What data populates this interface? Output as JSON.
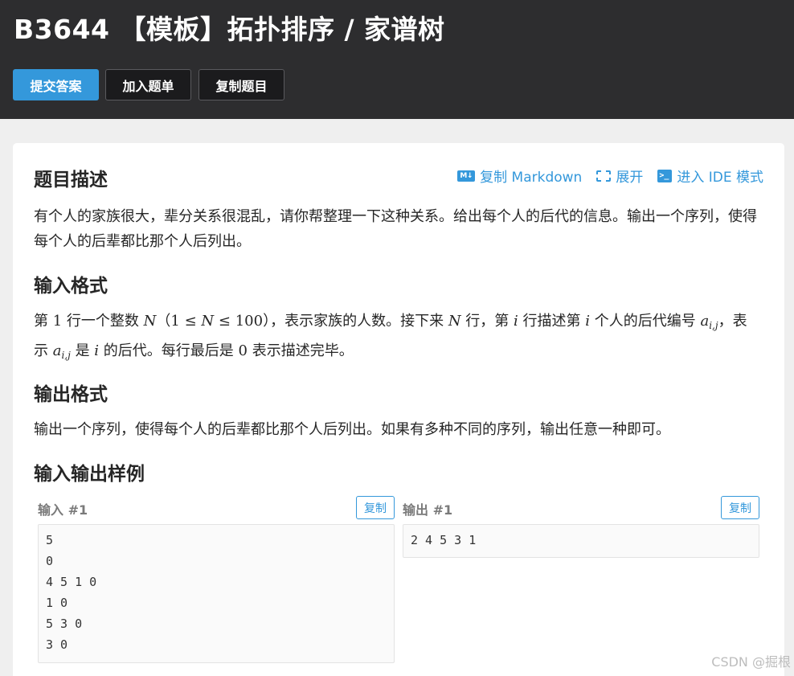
{
  "header": {
    "title": "B3644 【模板】拓扑排序 / 家谱树",
    "buttons": {
      "submit": "提交答案",
      "add_to_list": "加入题单",
      "copy_problem": "复制题目"
    }
  },
  "problem": {
    "actions": {
      "copy_markdown": "复制 Markdown",
      "expand": "展开",
      "ide_mode": "进入 IDE 模式"
    },
    "description": {
      "heading": "题目描述",
      "text": "有个人的家族很大，辈分关系很混乱，请你帮整理一下这种关系。给出每个人的后代的信息。输出一个序列，使得每个人的后辈都比那个人后列出。"
    },
    "input_format": {
      "heading": "输入格式",
      "line1_a": "第 ",
      "line1_num": "1",
      "line1_b": " 行一个整数 ",
      "var_N": "N",
      "constraint_open": "（",
      "constraint_lo": "1",
      "le": "≤",
      "constraint_hi": "100",
      "constraint_close": "）",
      "line1_c": "，表示家族的人数。接下来 ",
      "line1_d": " 行，第 ",
      "var_i": "i",
      "line1_e": " 行描述第 ",
      "line1_f": " 个人的后代编",
      "line2_a": "号 ",
      "var_a": "a",
      "var_a_sub": "i,j",
      "line2_b": "，表示 ",
      "line2_c": " 是 ",
      "line2_d": " 的后代。每行最后是 ",
      "zero": "0",
      "line2_e": " 表示描述完毕。"
    },
    "output_format": {
      "heading": "输出格式",
      "text": "输出一个序列，使得每个人的后辈都比那个人后列出。如果有多种不同的序列，输出任意一种即可。"
    },
    "samples": {
      "heading": "输入输出样例",
      "input_label": "输入 #1",
      "output_label": "输出 #1",
      "copy_label": "复制",
      "input_lines": [
        "5",
        "0",
        "4 5 1 0",
        "1 0",
        "5 3 0",
        "3 0"
      ],
      "output_lines": [
        "2 4 5 3 1"
      ]
    }
  },
  "watermark": "CSDN @掘根"
}
